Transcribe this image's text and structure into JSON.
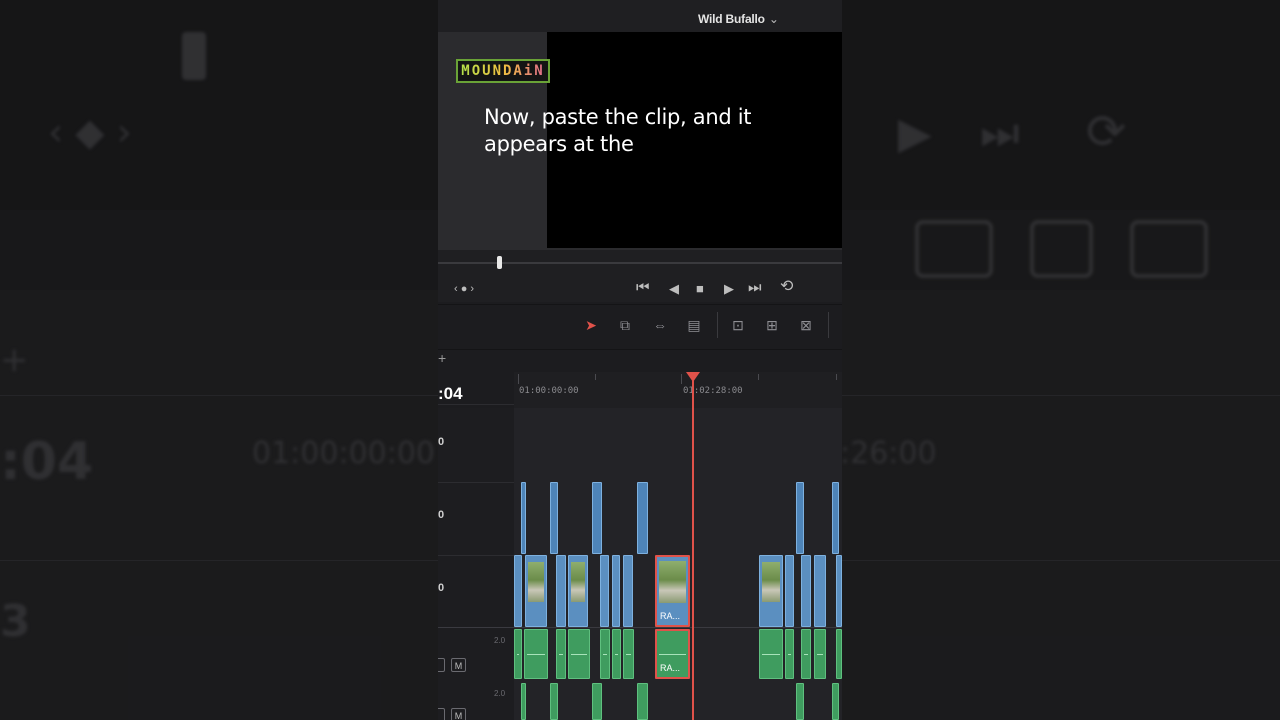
{
  "viewer": {
    "clip_name": "Wild Bufallo",
    "chevron": "⌄"
  },
  "overlay": {
    "brand": "MOUNDAiN",
    "caption": "Now, paste the clip, and it appears at the"
  },
  "timeline": {
    "timecode": ":04",
    "ruler_labels": [
      "01:00:00:00",
      "01:02:28:00"
    ],
    "track_labels": [
      "0",
      "0",
      "0"
    ],
    "audio_channels": [
      "2.0",
      "2.0"
    ],
    "mute_label": "M",
    "pasted_clip_label": "RA...",
    "add_track": "+"
  },
  "background": {
    "ghost_timecode": ":04",
    "ghost_ruler_1": "01:00:00:00",
    "ghost_ruler_2": ":26:00",
    "ghost_track": "3"
  },
  "colors": {
    "playhead": "#e0524a",
    "video_clip": "#5b8fc0",
    "audio_clip": "#3f9c5f",
    "selection_tool": "#e0524a"
  }
}
